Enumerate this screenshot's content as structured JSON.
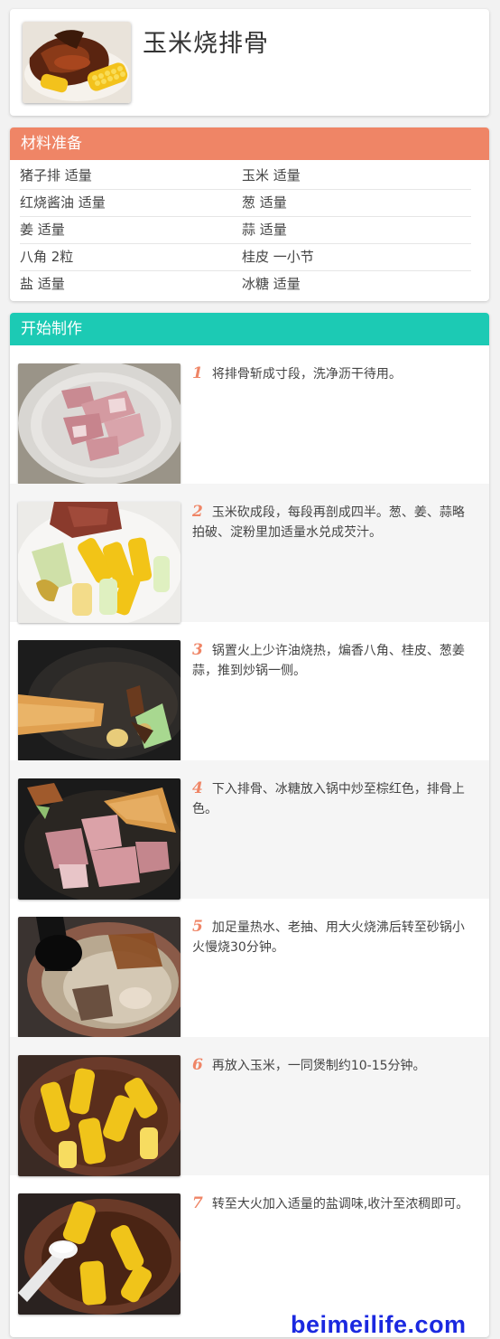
{
  "recipe": {
    "title": "玉米烧排骨"
  },
  "ingredients": {
    "header": "材料准备",
    "rows": [
      {
        "left": "猪子排 适量",
        "right": "玉米 适量"
      },
      {
        "left": "红烧酱油 适量",
        "right": "葱 适量"
      },
      {
        "left": "姜 适量",
        "right": "蒜 适量"
      },
      {
        "left": "八角 2粒",
        "right": "桂皮 一小节"
      },
      {
        "left": "盐 适量",
        "right": "冰糖 适量"
      }
    ]
  },
  "steps": {
    "header": "开始制作",
    "items": [
      {
        "num": "1",
        "text": "将排骨斩成寸段，洗净沥干待用。"
      },
      {
        "num": "2",
        "text": "玉米砍成段，每段再剖成四半。葱、姜、蒜略拍破、淀粉里加适量水兑成芡汁。"
      },
      {
        "num": "3",
        "text": "锅置火上少许油烧热，煸香八角、桂皮、葱姜蒜，推到炒锅一侧。"
      },
      {
        "num": "4",
        "text": "下入排骨、冰糖放入锅中炒至棕红色，排骨上色。"
      },
      {
        "num": "5",
        "text": "加足量热水、老抽、用大火烧沸后转至砂锅小火慢烧30分钟。"
      },
      {
        "num": "6",
        "text": "再放入玉米，一同煲制约10-15分钟。"
      },
      {
        "num": "7",
        "text": "转至大火加入适量的盐调味,收汁至浓稠即可。"
      }
    ]
  },
  "watermark": "beimeilife.com",
  "colors": {
    "ingredients_header": "#ef8566",
    "steps_header": "#1ccab4",
    "step_number": "#ef8566",
    "watermark": "#1a28e0"
  }
}
